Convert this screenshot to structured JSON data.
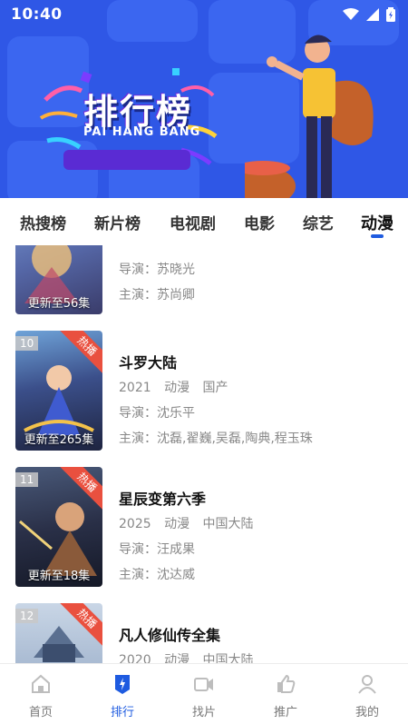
{
  "status_bar": {
    "time": "10:40"
  },
  "banner": {
    "title": "排行榜",
    "subtitle": "PAI HANG BANG"
  },
  "tabs": [
    {
      "label": "热搜榜"
    },
    {
      "label": "新片榜"
    },
    {
      "label": "电视剧"
    },
    {
      "label": "电影"
    },
    {
      "label": "综艺"
    },
    {
      "label": "动漫",
      "active": true
    }
  ],
  "list": [
    {
      "rank": "",
      "hot": "",
      "episodes": "更新至56集",
      "title": "",
      "year": "",
      "category": "",
      "region": "",
      "director": "导演：苏晓光",
      "cast": "主演：苏尚卿"
    },
    {
      "rank": "10",
      "hot": "热播",
      "episodes": "更新至265集",
      "title": "斗罗大陆",
      "year": "2021",
      "category": "动漫",
      "region": "国产",
      "director": "导演：沈乐平",
      "cast": "主演：沈磊,翟巍,吴磊,陶典,程玉珠"
    },
    {
      "rank": "11",
      "hot": "热播",
      "episodes": "更新至18集",
      "title": "星辰变第六季",
      "year": "2025",
      "category": "动漫",
      "region": "中国大陆",
      "director": "导演：汪成果",
      "cast": "主演：沈达威"
    },
    {
      "rank": "12",
      "hot": "热播",
      "episodes": "",
      "title": "凡人修仙传全集",
      "year": "2020",
      "category": "动漫",
      "region": "中国大陆",
      "director": "",
      "cast": ""
    }
  ],
  "bottom_nav": [
    {
      "label": "首页",
      "icon": "home-icon"
    },
    {
      "label": "排行",
      "icon": "ranking-icon",
      "active": true
    },
    {
      "label": "找片",
      "icon": "video-camera-icon"
    },
    {
      "label": "推广",
      "icon": "thumbs-up-icon"
    },
    {
      "label": "我的",
      "icon": "user-icon"
    }
  ],
  "colors": {
    "banner_blue": "#2f57e6",
    "accent": "#1e5be0",
    "hot_red": "#e9503f"
  }
}
